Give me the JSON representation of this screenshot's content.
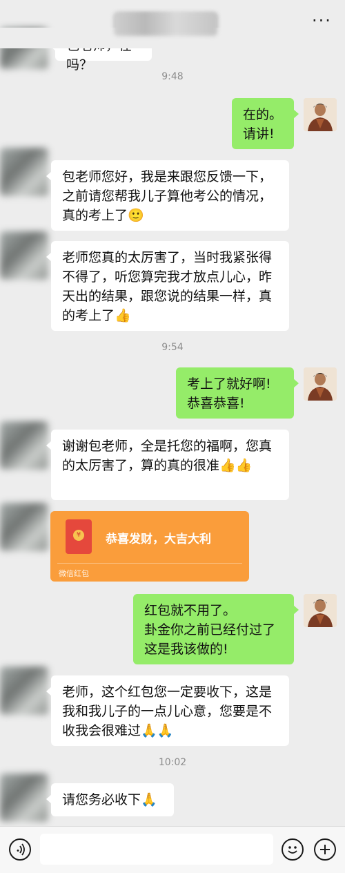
{
  "header": {
    "more_label": "···"
  },
  "messages": {
    "top_partial": "包老师，在吗？",
    "time1": "9:48",
    "m1": "在的。\n请讲!",
    "m2": "包老师您好，我是来跟您反馈一下，之前请您帮我儿子算他考公的情况，真的考上了🙂",
    "m3": "老师您真的太厉害了，当时我紧张得不得了，听您算完我才放点儿心，昨天出的结果，跟您说的结果一样，真的考上了👍",
    "time2": "9:54",
    "m4": "考上了就好啊!\n恭喜恭喜!",
    "m5": "谢谢包老师，全是托您的福啊，您真的太厉害了，算的真的很准👍👍",
    "red_packet": {
      "title": "恭喜发财，大吉大利",
      "footer": "微信红包",
      "coin_symbol": "¥"
    },
    "m6": "红包就不用了。\n卦金你之前已经付过了\n这是我该做的!",
    "m7": "老师，这个红包您一定要收下，这是我和我儿子的一点儿心意，您要是不收我会很难过🙏🙏",
    "time3": "10:02",
    "m8": "请您务必收下🙏"
  },
  "bottom_bar": {
    "voice_icon": "voice-icon",
    "emoji_icon": "emoji-icon",
    "add_icon": "add-icon",
    "input_value": ""
  },
  "colors": {
    "background": "#ededed",
    "green_bubble": "#95ec69",
    "red_packet": "#fa9d3b",
    "red_packet_icon": "#e5483c"
  }
}
